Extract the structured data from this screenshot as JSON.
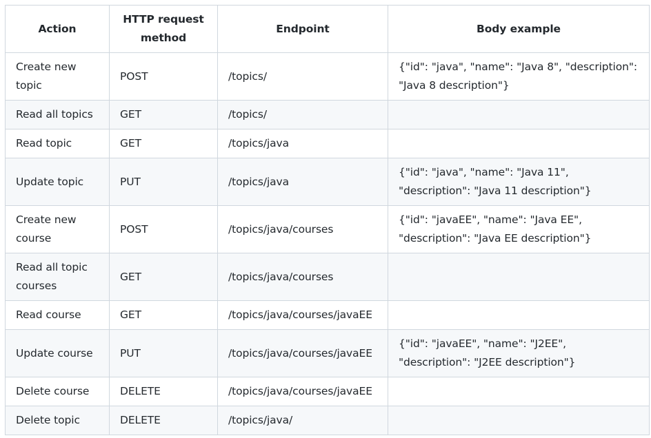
{
  "headers": [
    "Action",
    "HTTP request method",
    "Endpoint",
    "Body example"
  ],
  "rows": [
    {
      "action": "Create new topic",
      "method": "POST",
      "endpoint": "/topics/",
      "body": "{\"id\": \"java\", \"name\": \"Java 8\", \"description\": \"Java 8 description\"}"
    },
    {
      "action": "Read all topics",
      "method": "GET",
      "endpoint": "/topics/",
      "body": ""
    },
    {
      "action": "Read topic",
      "method": "GET",
      "endpoint": "/topics/java",
      "body": ""
    },
    {
      "action": "Update topic",
      "method": "PUT",
      "endpoint": "/topics/java",
      "body": "{\"id\": \"java\", \"name\": \"Java 11\", \"description\": \"Java 11 description\"}"
    },
    {
      "action": "Create new course",
      "method": "POST",
      "endpoint": "/topics/java/courses",
      "body": "{\"id\": \"javaEE\", \"name\": \"Java EE\", \"description\": \"Java EE description\"}"
    },
    {
      "action": "Read all topic courses",
      "method": "GET",
      "endpoint": "/topics/java/courses",
      "body": ""
    },
    {
      "action": "Read course",
      "method": "GET",
      "endpoint": "/topics/java/courses/javaEE",
      "body": ""
    },
    {
      "action": "Update course",
      "method": "PUT",
      "endpoint": "/topics/java/courses/javaEE",
      "body": "{\"id\": \"javaEE\", \"name\": \"J2EE\", \"description\": \"J2EE description\"}"
    },
    {
      "action": "Delete course",
      "method": "DELETE",
      "endpoint": "/topics/java/courses/javaEE",
      "body": ""
    },
    {
      "action": "Delete topic",
      "method": "DELETE",
      "endpoint": "/topics/java/",
      "body": ""
    }
  ]
}
